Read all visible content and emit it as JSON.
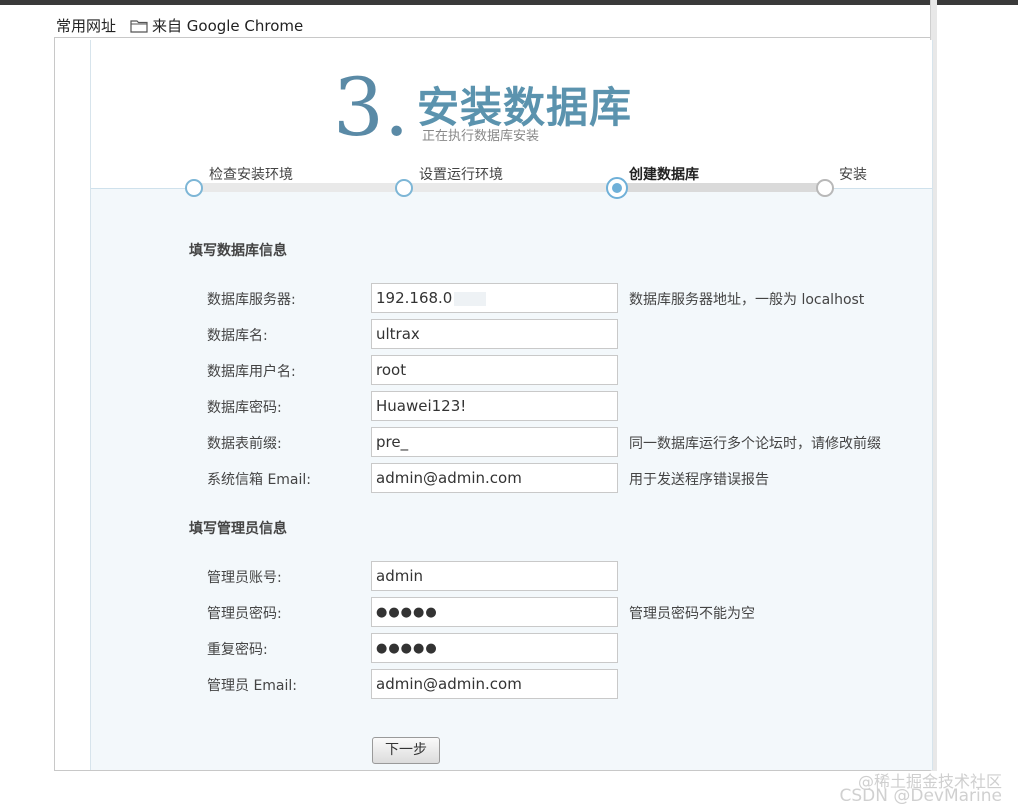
{
  "bookmarks": {
    "item1": "常用网址",
    "item2_icon": "folder-icon",
    "item2": "来自 Google Chrome"
  },
  "header": {
    "step_number": "3.",
    "title": "安装数据库",
    "subtitle": "正在执行数据库安装"
  },
  "progress": {
    "steps": [
      {
        "label": "检查安装环境",
        "state": "done"
      },
      {
        "label": "设置运行环境",
        "state": "done"
      },
      {
        "label": "创建数据库",
        "state": "current"
      },
      {
        "label": "安装",
        "state": "todo"
      }
    ],
    "fraction_complete": 0.67
  },
  "db_section": {
    "title": "填写数据库信息",
    "fields": [
      {
        "label": "数据库服务器:",
        "value": "192.168.0",
        "hint": "数据库服务器地址，一般为 localhost"
      },
      {
        "label": "数据库名:",
        "value": "ultrax",
        "hint": ""
      },
      {
        "label": "数据库用户名:",
        "value": "root",
        "hint": ""
      },
      {
        "label": "数据库密码:",
        "value": "Huawei123!",
        "hint": ""
      },
      {
        "label": "数据表前缀:",
        "value": "pre_",
        "hint": "同一数据库运行多个论坛时，请修改前缀"
      },
      {
        "label": "系统信箱 Email:",
        "value": "admin@admin.com",
        "hint": "用于发送程序错误报告"
      }
    ]
  },
  "admin_section": {
    "title": "填写管理员信息",
    "fields": [
      {
        "label": "管理员账号:",
        "value": "admin",
        "hint": ""
      },
      {
        "label": "管理员密码:",
        "value": "●●●●●",
        "hint": "管理员密码不能为空"
      },
      {
        "label": "重复密码:",
        "value": "●●●●●",
        "hint": ""
      },
      {
        "label": "管理员 Email:",
        "value": "admin@admin.com",
        "hint": ""
      }
    ]
  },
  "next_button": "下一步",
  "watermark": {
    "line1": "@稀土掘金技术社区",
    "line2": "CSDN @DevMarine"
  },
  "colors": {
    "accent": "#5b93ae",
    "step_active": "#6fb0d8",
    "body_bg": "#f3f8fb"
  }
}
